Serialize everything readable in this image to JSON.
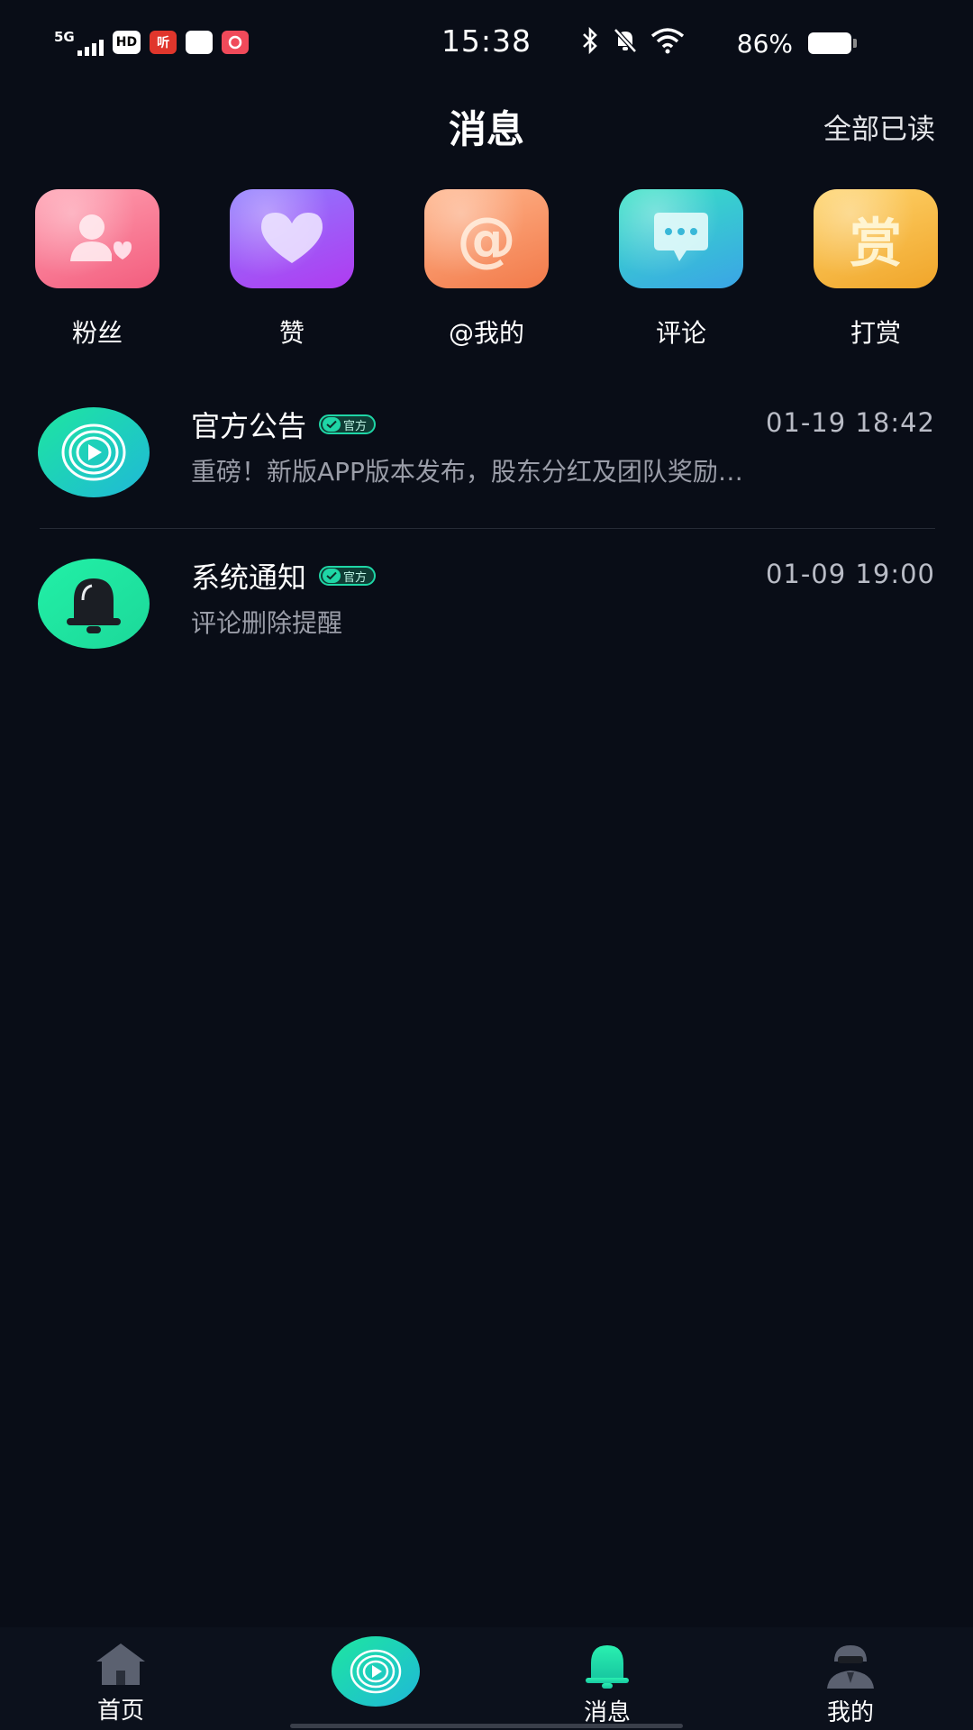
{
  "status_bar": {
    "network": "5G",
    "hd": "HD",
    "app_chip": "听",
    "time": "15:38",
    "battery": "86%"
  },
  "header": {
    "title": "消息",
    "mark_all_read": "全部已读"
  },
  "categories": [
    {
      "label": "粉丝",
      "icon": "fans-icon"
    },
    {
      "label": "赞",
      "icon": "heart-icon"
    },
    {
      "label": "@我的",
      "icon": "at-icon",
      "glyph": "@"
    },
    {
      "label": "评论",
      "icon": "comment-icon"
    },
    {
      "label": "打赏",
      "icon": "reward-icon",
      "glyph": "赏"
    }
  ],
  "messages": [
    {
      "name": "官方公告",
      "badge": "官方",
      "time": "01-19 18:42",
      "preview": "重磅！新版APP版本发布，股东分红及团队奖励…",
      "icon": "play-icon"
    },
    {
      "name": "系统通知",
      "badge": "官方",
      "time": "01-09 19:00",
      "preview": "评论删除提醒",
      "icon": "bell-icon"
    }
  ],
  "nav": {
    "home": "首页",
    "messages": "消息",
    "mine": "我的"
  },
  "colors": {
    "background": "#090d17",
    "accent": "#1fd6a6"
  }
}
